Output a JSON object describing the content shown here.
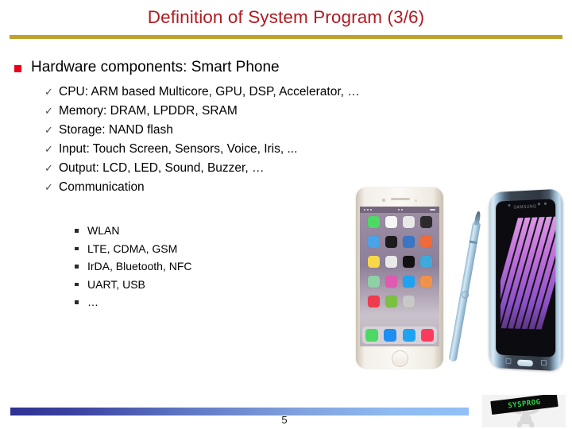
{
  "slide": {
    "title": "Definition of System Program (3/6)",
    "page_number": "5",
    "title_color": "#B11B22",
    "rule_color": "#BFA22A",
    "bullet_color": "#E8001C",
    "footer_gradient_start": "#2E3192",
    "footer_gradient_end": "#92C0F6"
  },
  "content": {
    "heading": "Hardware components: Smart Phone",
    "heading_marker": "square-bullet-icon",
    "level2": [
      {
        "marker": "check-icon",
        "text": "CPU: ARM based Multicore, GPU, DSP, Accelerator, …"
      },
      {
        "marker": "check-icon",
        "text": "Memory: DRAM, LPDDR, SRAM"
      },
      {
        "marker": "check-icon",
        "text": "Storage: NAND flash"
      },
      {
        "marker": "check-icon",
        "text": "Input: Touch Screen, Sensors, Voice, Iris, ..."
      },
      {
        "marker": "check-icon",
        "text": "Output: LCD, LED, Sound, Buzzer, …"
      },
      {
        "marker": "check-icon",
        "text": "Communication"
      }
    ],
    "level3": [
      {
        "marker": "small-square-icon",
        "text": "WLAN"
      },
      {
        "marker": "small-square-icon",
        "text": "LTE, CDMA, GSM"
      },
      {
        "marker": "small-square-icon",
        "text": "IrDA, Bluetooth, NFC"
      },
      {
        "marker": "small-square-icon",
        "text": "UART, USB"
      },
      {
        "marker": "small-square-icon",
        "text": "…"
      }
    ]
  },
  "images": {
    "phone_left": {
      "name": "iphone-photo",
      "status_time": "",
      "ios_icon_colors": [
        "#4cd964",
        "#f6f6f6",
        "#e8e8e8",
        "#2b2b2b",
        "#4aa3e8",
        "#1c1c1c",
        "#3b76c4",
        "#f06a3a",
        "#f7d84a",
        "#e9e9e9",
        "#111111",
        "#3fa9dc",
        "#8ed1a6",
        "#e05bb0",
        "#1fa3f0",
        "#f0924a",
        "#ef3b4e",
        "#7bc043",
        "#c8c8c8"
      ],
      "dock_icon_colors": [
        "#4cd964",
        "#1f8ef1",
        "#1fa3f0",
        "#fb3b5c"
      ]
    },
    "phone_right": {
      "name": "samsung-galaxy-note-photo",
      "brand_text": "SAMSUNG",
      "stylus": "s-pen-stylus"
    }
  },
  "logo": {
    "text": "SYSPROG",
    "text_color": "#2fd44a",
    "banner_color": "#0a0a0a"
  }
}
